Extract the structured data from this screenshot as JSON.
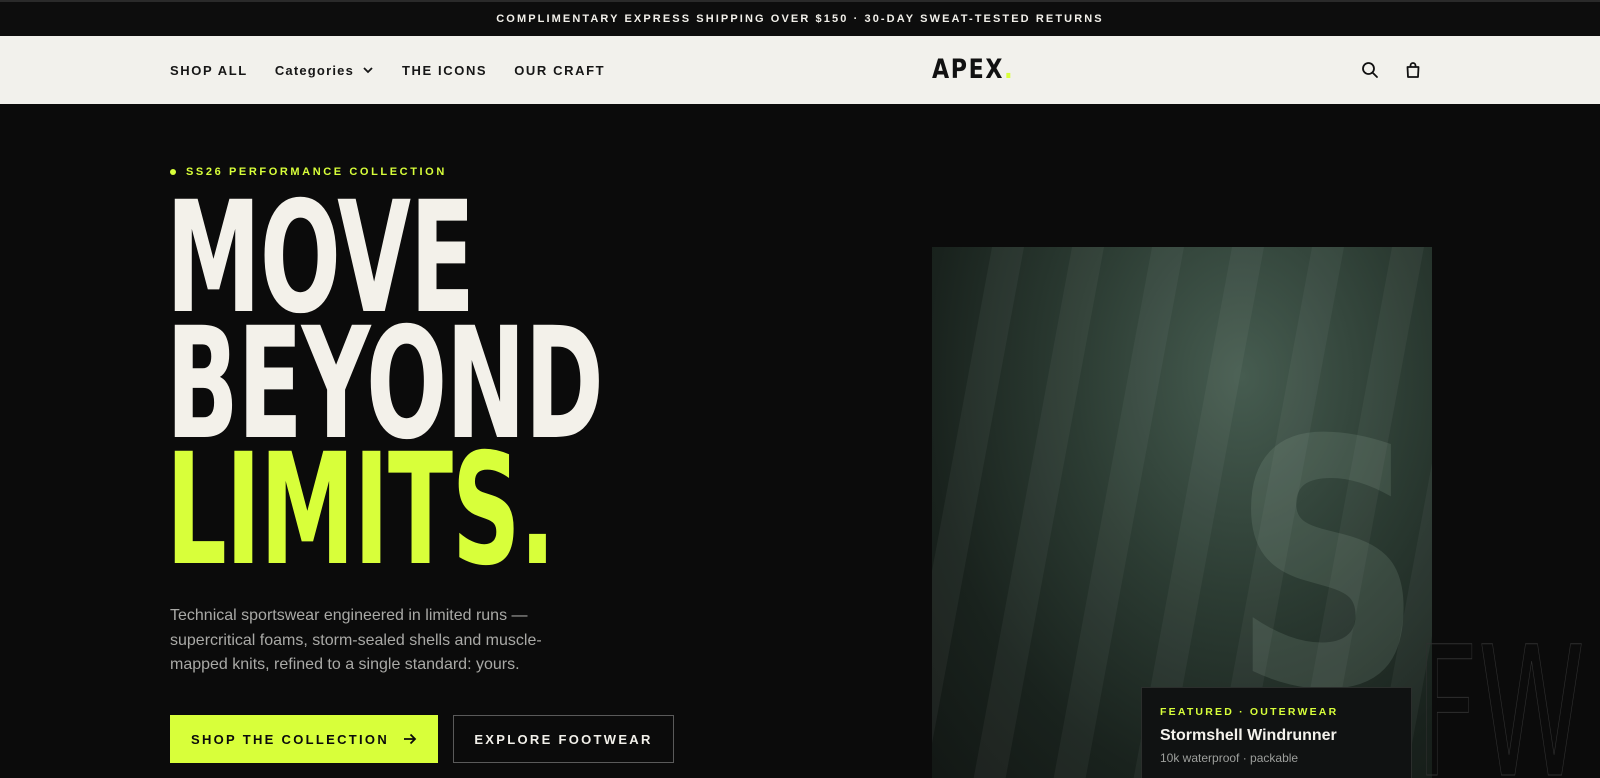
{
  "announcement": "COMPLIMENTARY EXPRESS SHIPPING OVER $150 · 30-DAY SWEAT-TESTED RETURNS",
  "nav": {
    "links": [
      "SHOP ALL",
      "Categories",
      "THE ICONS",
      "OUR CRAFT"
    ],
    "logo_text": "APEX",
    "logo_dot": ".",
    "icons": [
      "search-icon",
      "bag-icon"
    ]
  },
  "hero": {
    "eyebrow": "SS26 PERFORMANCE COLLECTION",
    "headline": [
      "MOVE",
      "BEYOND",
      "LIMITS."
    ],
    "description": "Technical sportswear engineered in limited runs — supercritical foams, storm-sealed shells and muscle-mapped knits, refined to a single standard: yours.",
    "primary_cta": "SHOP THE COLLECTION",
    "secondary_cta": "EXPLORE FOOTWEAR",
    "card_letter": "S",
    "ghost_text": "FW"
  },
  "featured": {
    "tag": "FEATURED · OUTERWEAR",
    "title": "Stormshell Windrunner",
    "subtitle": "10k waterproof · packable"
  },
  "colors": {
    "accent": "#d8ff3a",
    "background": "#0b0b0b",
    "nav_bg": "#f2f1ec"
  }
}
